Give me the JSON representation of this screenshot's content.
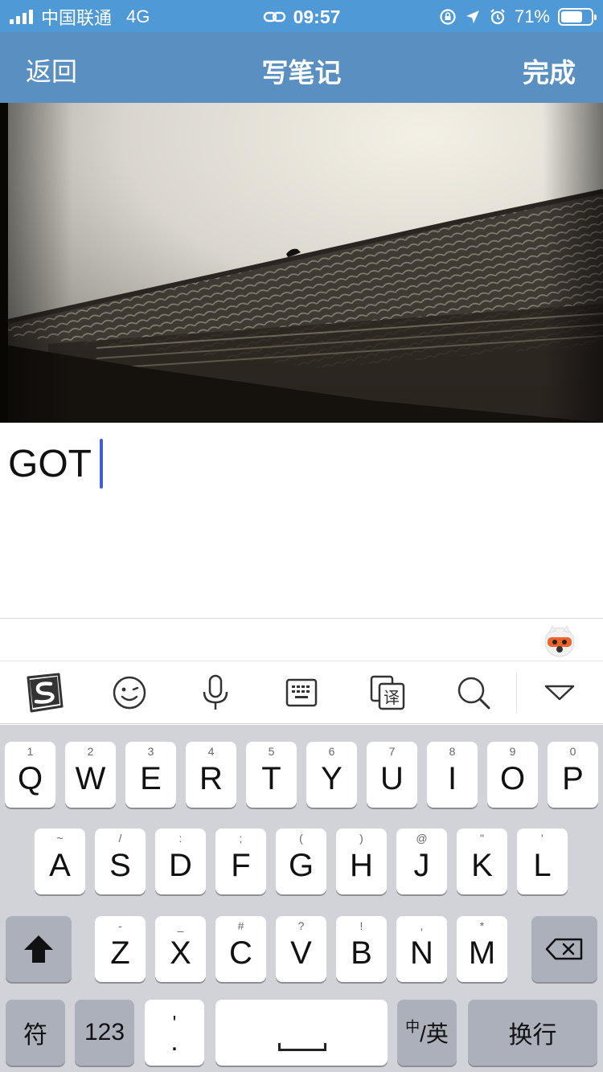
{
  "status_bar": {
    "carrier": "中国联通",
    "network": "4G",
    "time": "09:57",
    "battery": "71%",
    "battery_level": 0.71
  },
  "nav": {
    "back_label": "返回",
    "title": "写笔记",
    "done_label": "完成",
    "color": "#5990c1"
  },
  "editor": {
    "text": "GOT",
    "caret_color": "#3f5fd8"
  },
  "ime_toolbar": {
    "icons": [
      "sogou-logo-icon",
      "emoji-icon",
      "microphone-icon",
      "keyboard-icon",
      "translate-icon",
      "search-icon",
      "collapse-keyboard-icon"
    ],
    "translate_glyph": "译"
  },
  "keyboard": {
    "row1": [
      {
        "main": "Q",
        "sub": "1"
      },
      {
        "main": "W",
        "sub": "2"
      },
      {
        "main": "E",
        "sub": "3"
      },
      {
        "main": "R",
        "sub": "4"
      },
      {
        "main": "T",
        "sub": "5"
      },
      {
        "main": "Y",
        "sub": "6"
      },
      {
        "main": "U",
        "sub": "7"
      },
      {
        "main": "I",
        "sub": "8"
      },
      {
        "main": "O",
        "sub": "9"
      },
      {
        "main": "P",
        "sub": "0"
      }
    ],
    "row2": [
      {
        "main": "A",
        "sub": "~"
      },
      {
        "main": "S",
        "sub": "/"
      },
      {
        "main": "D",
        "sub": ":"
      },
      {
        "main": "F",
        "sub": ";"
      },
      {
        "main": "G",
        "sub": "("
      },
      {
        "main": "H",
        "sub": ")"
      },
      {
        "main": "J",
        "sub": "@"
      },
      {
        "main": "K",
        "sub": "\""
      },
      {
        "main": "L",
        "sub": "'"
      }
    ],
    "row3": [
      {
        "main": "Z",
        "sub": "-"
      },
      {
        "main": "X",
        "sub": "_"
      },
      {
        "main": "C",
        "sub": "#"
      },
      {
        "main": "V",
        "sub": "?"
      },
      {
        "main": "B",
        "sub": "!"
      },
      {
        "main": "N",
        "sub": ","
      },
      {
        "main": "M",
        "sub": "*"
      }
    ],
    "symbols_label": "符",
    "numbers_label": "123",
    "punct_main": ".",
    "punct_sub": "'",
    "lang_small": "中",
    "lang_main": "/英",
    "return_label": "换行"
  }
}
